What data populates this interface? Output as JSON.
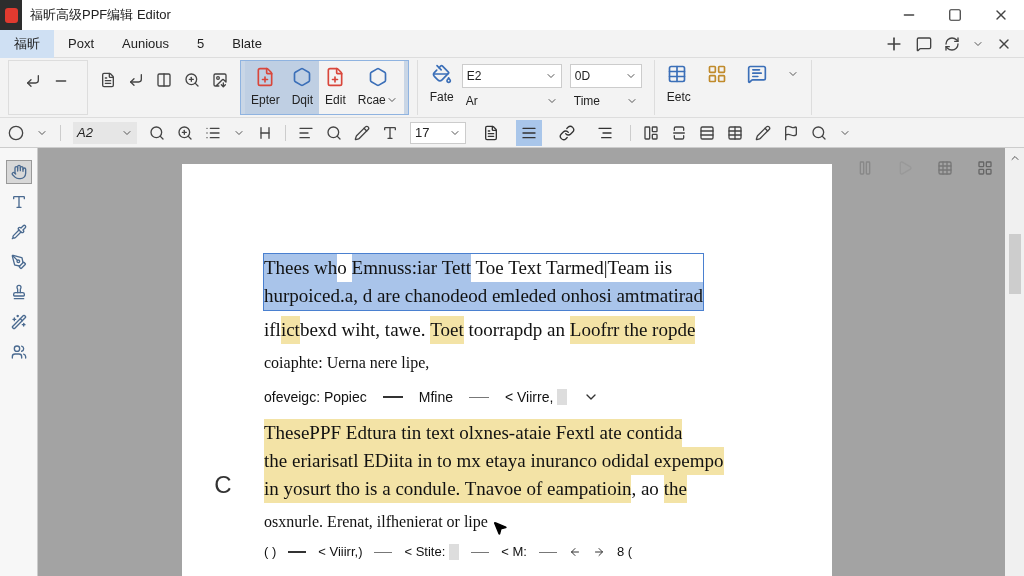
{
  "window": {
    "title": "福昕高级PPF编辑 Editor"
  },
  "menu_tabs": [
    {
      "label": "福昕",
      "selected": true
    },
    {
      "label": "Poxt",
      "selected": false
    },
    {
      "label": "Aunious",
      "selected": false
    },
    {
      "label": "5",
      "selected": false
    },
    {
      "label": "Blate",
      "selected": false
    }
  ],
  "ribbon": {
    "large_buttons": [
      {
        "label": "Epter",
        "selected": true
      },
      {
        "label": "Dqit",
        "selected": true
      },
      {
        "label": "Edit",
        "selected": false
      },
      {
        "label": "Rcae",
        "selected": false
      }
    ],
    "fill_label": "Fate",
    "font_label": "Ar",
    "font_combo": "E2",
    "size_combo": "0D",
    "size_label": "Time",
    "extra_label": "Eetc"
  },
  "format_toolbar": {
    "style_combo": "A2",
    "size_combo": "17",
    "align_tools": [
      {
        "selected": false
      },
      {
        "selected": true
      },
      {
        "selected": false
      },
      {
        "selected": false
      }
    ]
  },
  "left_tools": [
    {
      "selected": true
    },
    {
      "selected": false
    },
    {
      "selected": false
    },
    {
      "selected": false
    },
    {
      "selected": false
    },
    {
      "selected": false
    },
    {
      "selected": false
    }
  ],
  "page": {
    "margin_mark": "C",
    "paragraph_1": [
      [
        {
          "text": "Thees wh",
          "selected": true,
          "highlighted": false
        },
        {
          "text": "o ",
          "selected": false,
          "highlighted": false
        },
        {
          "text": "Emnuss:iar ",
          "selected": true,
          "highlighted": false
        },
        {
          "text": "Tett",
          "selected": true,
          "highlighted": false
        },
        {
          "text": " Toe Text Tarmed|Team iis",
          "selected": false,
          "highlighted": false
        }
      ],
      [
        {
          "text": "hurpoiced.a, ",
          "selected": true,
          "highlighted": false
        },
        {
          "text": "d are chanodeod emleded onhosi amtmatirad",
          "selected": true,
          "highlighted": false
        }
      ],
      [
        {
          "text": "ifl",
          "selected": false,
          "highlighted": false
        },
        {
          "text": "ict",
          "selected": false,
          "highlighted": true
        },
        {
          "text": "bexd wiht, tawe. ",
          "selected": false,
          "highlighted": false
        },
        {
          "text": "Toet",
          "selected": false,
          "highlighted": true
        },
        {
          "text": " toorrapdp an ",
          "selected": false,
          "highlighted": false
        },
        {
          "text": "Loofrr the ropde",
          "selected": false,
          "highlighted": true
        }
      ]
    ],
    "note_1": "coiaphte: Uerna nere lipe,",
    "field_line_1": {
      "label": "ofeveigc: Popiec",
      "middle": "Mfine",
      "end": "< Viirre,"
    },
    "paragraph_2": [
      [
        {
          "text": "ThesePPF Edtura ",
          "selected": false,
          "highlighted": true
        },
        {
          "text": "tin text olxnes-ataie Fextl ate contida",
          "selected": false,
          "highlighted": true
        }
      ],
      [
        {
          "text": "the eriarisatl EDiita ",
          "selected": false,
          "highlighted": true
        },
        {
          "text": "in to mx etaya inuranco odidal expempo",
          "selected": false,
          "highlighted": true
        }
      ],
      [
        {
          "text": "in yosurt tho is a condule. Tnavoe of eampatioin",
          "selected": false,
          "highlighted": true
        },
        {
          "text": ", ao ",
          "selected": false,
          "highlighted": false
        },
        {
          "text": "the",
          "selected": false,
          "highlighted": true
        }
      ]
    ],
    "note_2": "osxnurle. Erenat, ilfhenierat or lipe",
    "field_line_2": {
      "start": "( )",
      "first": "< Viiirr,)",
      "second": "< Stite:",
      "third": "< M:",
      "end": "8 ("
    }
  }
}
